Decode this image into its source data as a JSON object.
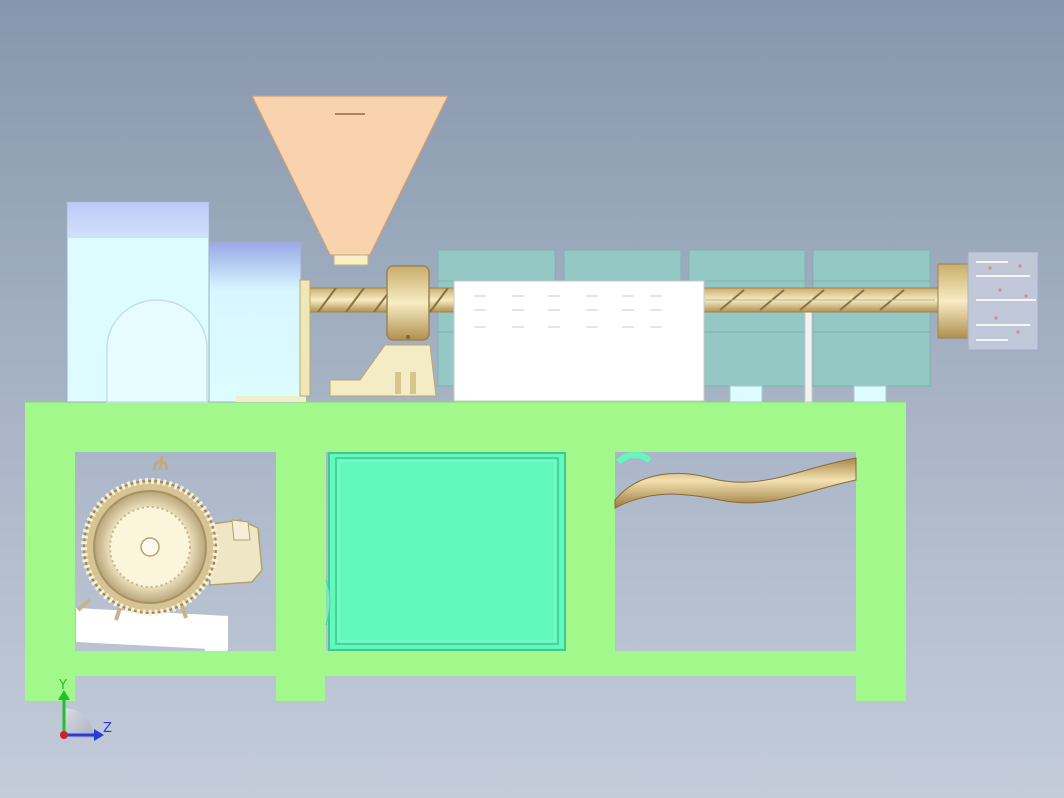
{
  "viewport": {
    "background_top": "#8796ac",
    "background_bottom": "#c4ccda"
  },
  "model": {
    "frame_color": "#a3f88c",
    "hopper_color": "#f9d2ae",
    "gearbox_color": "#dcfcff",
    "heater_color": "#93c8c5",
    "cover_color": "#ffffff",
    "cabinet_color": "#62f9bc",
    "brass_color": "#e8d6a0",
    "motor_color": "#f0e8c8"
  },
  "triad": {
    "y_label": "Y",
    "z_label": "Z",
    "y_color": "#22c02a",
    "z_color": "#2a3ad8",
    "x_color": "#d82020"
  }
}
